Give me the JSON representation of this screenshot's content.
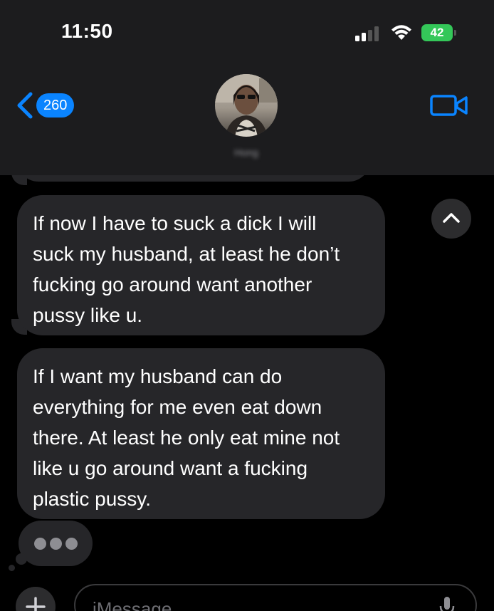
{
  "status_bar": {
    "time": "11:50",
    "battery": "42"
  },
  "header": {
    "back_badge": "260",
    "contact_name": "Hong",
    "icons": [
      "chevron-left-icon",
      "facetime-video-icon"
    ]
  },
  "messages": [
    {
      "direction": "incoming",
      "text": "If now I have to suck a dick I will\nsuck my husband, at least he don’t\nfucking go around want another\npussy like u."
    },
    {
      "direction": "incoming",
      "text": "If I want my husband can do\neverything for me even eat down\nthere. At least he only eat mine not\nlike u go around want a fucking\nplastic pussy."
    }
  ],
  "typing_indicator": {
    "visible": true
  },
  "input_bar": {
    "placeholder": "iMessage"
  },
  "colors": {
    "accent": "#0a84ff",
    "bubble_incoming": "#262629",
    "battery": "#34c759",
    "background": "#000000"
  }
}
